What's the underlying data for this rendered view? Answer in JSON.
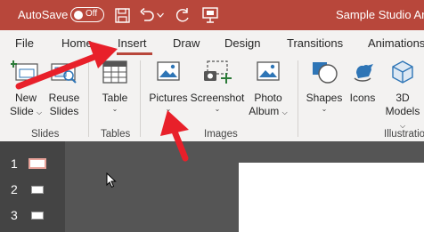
{
  "titlebar": {
    "autosave_label": "AutoSave",
    "autosave_state": "Off",
    "document_title": "Sample Studio Art",
    "icons": [
      "save-icon",
      "undo-icon",
      "redo-icon",
      "touch-mode-icon"
    ]
  },
  "tabs": [
    {
      "label": "File"
    },
    {
      "label": "Home"
    },
    {
      "label": "Insert",
      "active": true
    },
    {
      "label": "Draw"
    },
    {
      "label": "Design"
    },
    {
      "label": "Transitions"
    },
    {
      "label": "Animations"
    }
  ],
  "ribbon": {
    "groups": {
      "slides": "Slides",
      "tables": "Tables",
      "images": "Images",
      "illustrations": "Illustratio"
    },
    "buttons": {
      "new_slide": {
        "line1": "New",
        "line2": "Slide"
      },
      "reuse_slides": {
        "line1": "Reuse",
        "line2": "Slides"
      },
      "table": {
        "line1": "Table"
      },
      "pictures": {
        "line1": "Pictures"
      },
      "screenshot": {
        "line1": "Screenshot"
      },
      "photo_album": {
        "line1": "Photo",
        "line2": "Album"
      },
      "shapes": {
        "line1": "Shapes"
      },
      "icons": {
        "line1": "Icons"
      },
      "models_3d": {
        "line1": "3D",
        "line2": "Models"
      }
    },
    "caret": "⌄"
  },
  "thumbnails": {
    "numbers": [
      "1",
      "2",
      "3"
    ]
  },
  "colors": {
    "titlebar": "#b8473b",
    "ribbon": "#f3f2f1",
    "annotation_arrow": "#e8202a"
  }
}
